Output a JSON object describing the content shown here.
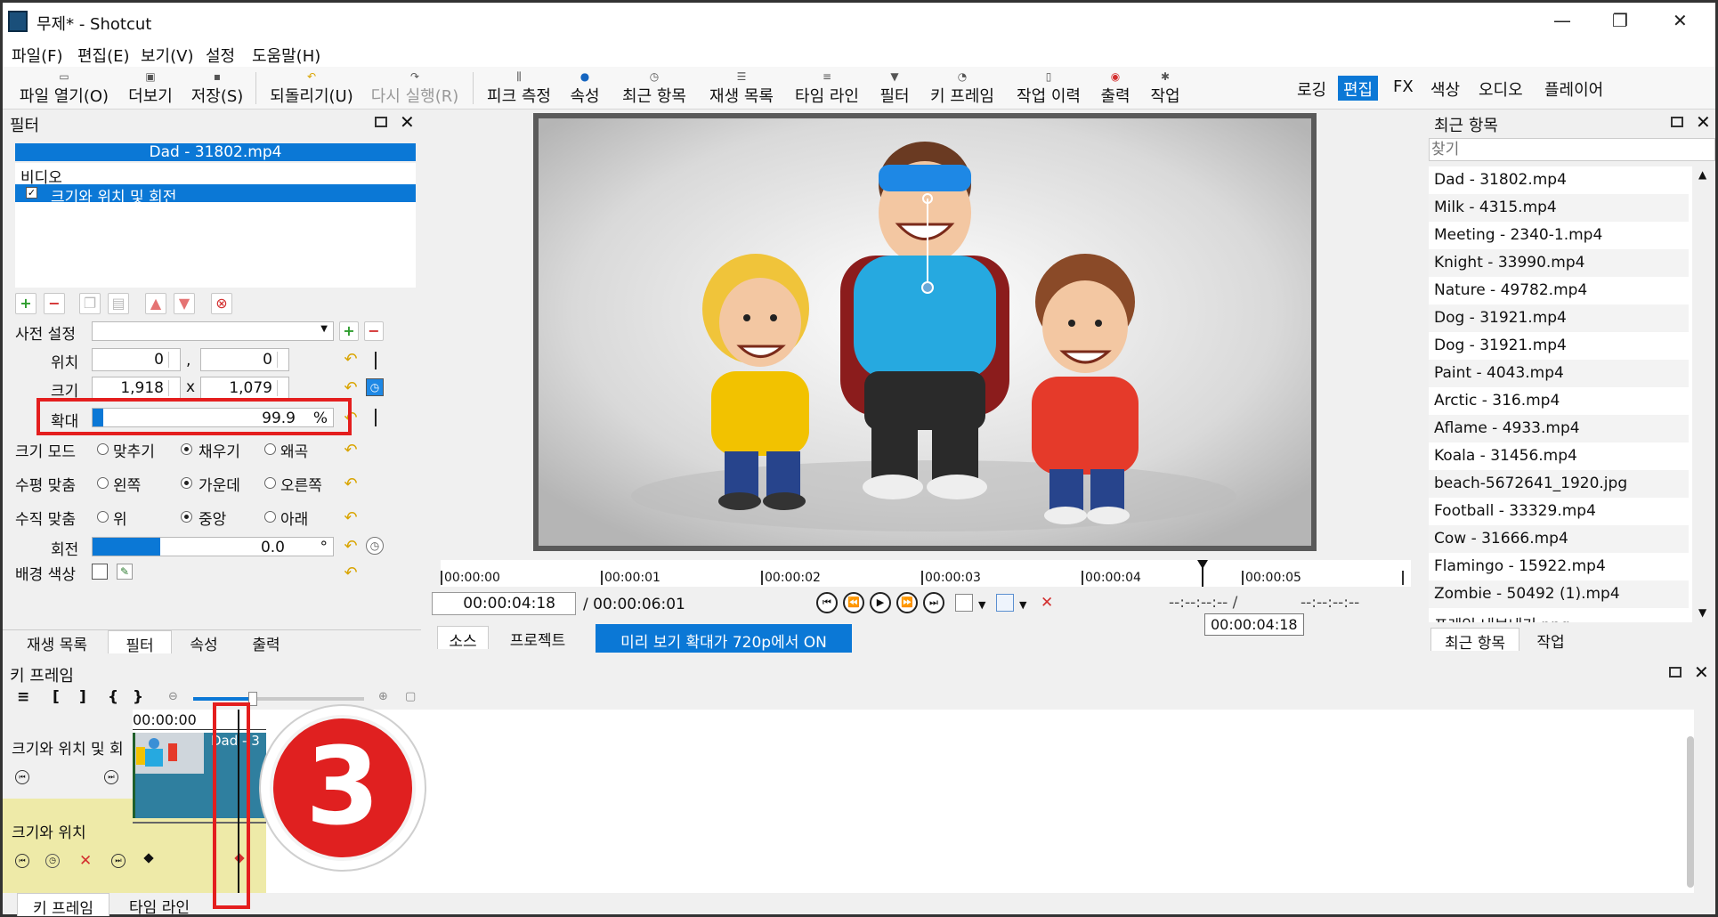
{
  "window": {
    "title": "무제* - Shotcut",
    "minimize": "—",
    "maximize": "❐",
    "close": "✕"
  },
  "menu": [
    "파일(F)",
    "편집(E)",
    "보기(V)",
    "설정",
    "도움말(H)"
  ],
  "toolbar": {
    "open": "파일 열기(O)",
    "more": "더보기",
    "save": "저장(S)",
    "undo": "되돌리기(U)",
    "redo": "다시 실행(R)",
    "peak": "피크 측정",
    "props": "속성",
    "recent": "최근 항목",
    "playlist": "재생 목록",
    "timeline": "타임 라인",
    "filter": "필터",
    "keyframe": "키 프레임",
    "history": "작업 이력",
    "output": "출력",
    "jobs": "작업"
  },
  "workspaces": [
    "로깅",
    "편집",
    "FX",
    "색상",
    "오디오",
    "플레이어"
  ],
  "filter_panel": {
    "title": "필터",
    "clip_name": "Dad - 31802.mp4",
    "section": "비디오",
    "filter_item": "크기와 위치 및 회전",
    "preset_label": "사전 설정",
    "position_label": "위치",
    "pos_x": "0",
    "pos_sep": ",",
    "pos_y": "0",
    "size_label": "크기",
    "size_w": "1,918",
    "size_sep": "x",
    "size_h": "1,079",
    "zoom_label": "확대",
    "zoom_value": "99.9",
    "zoom_unit": "%",
    "zoom_fraction": 0.01,
    "size_mode_label": "크기 모드",
    "size_mode_opts": [
      "맞추기",
      "채우기",
      "왜곡"
    ],
    "h_align_label": "수평 맞춤",
    "h_align_opts": [
      "왼쪽",
      "가운데",
      "오른쪽"
    ],
    "v_align_label": "수직 맞춤",
    "v_align_opts": [
      "위",
      "중앙",
      "아래"
    ],
    "rotation_label": "회전",
    "rotation_value": "0.0",
    "rotation_unit": "°",
    "bg_label": "배경 색상"
  },
  "left_tabs": [
    "재생 목록",
    "필터",
    "속성",
    "출력"
  ],
  "player": {
    "ticks": [
      "00:00:00",
      "00:00:01",
      "00:00:02",
      "00:00:03",
      "00:00:04",
      "00:00:05"
    ],
    "timecode": "00:00:04:18",
    "duration": "/ 00:00:06:01",
    "in_out": "--:--:--:-- /",
    "out": "--:--:--:--",
    "tooltip": "00:00:04:18",
    "tab_source": "소스",
    "tab_project": "프로젝트",
    "preview_msg": "미리 보기 확대가 720p에서 ON"
  },
  "recent": {
    "title": "최근 항목",
    "search_placeholder": "찾기",
    "items": [
      "Dad - 31802.mp4",
      "Milk - 4315.mp4",
      "Meeting - 2340-1.mp4",
      "Knight - 33990.mp4",
      "Nature - 49782.mp4",
      "Dog - 31921.mp4",
      "Dog - 31921.mp4",
      "Paint - 4043.mp4",
      "Arctic - 316.mp4",
      "Aflame - 4933.mp4",
      "Koala - 31456.mp4",
      "beach-5672641_1920.jpg",
      "Football - 33329.mp4",
      "Cow - 31666.mp4",
      "Flamingo - 15922.mp4",
      "Zombie - 50492 (1).mp4",
      "프레임 내보내기.png"
    ],
    "tabs": [
      "최근 항목",
      "작업"
    ]
  },
  "keyframes": {
    "title": "키 프레임",
    "toolbar": [
      "≡",
      "[",
      "]",
      "{",
      "}"
    ],
    "ruler_time": "00:00:00",
    "track1": "크기와 위치 및 회",
    "track2": "크기와 위치",
    "clip_label": "Dad - 3",
    "badge": "3",
    "bottom_tabs": [
      "키 프레임",
      "타임 라인"
    ]
  },
  "colors": {
    "accent": "#0b78d6",
    "highlight": "#e41e1e"
  }
}
